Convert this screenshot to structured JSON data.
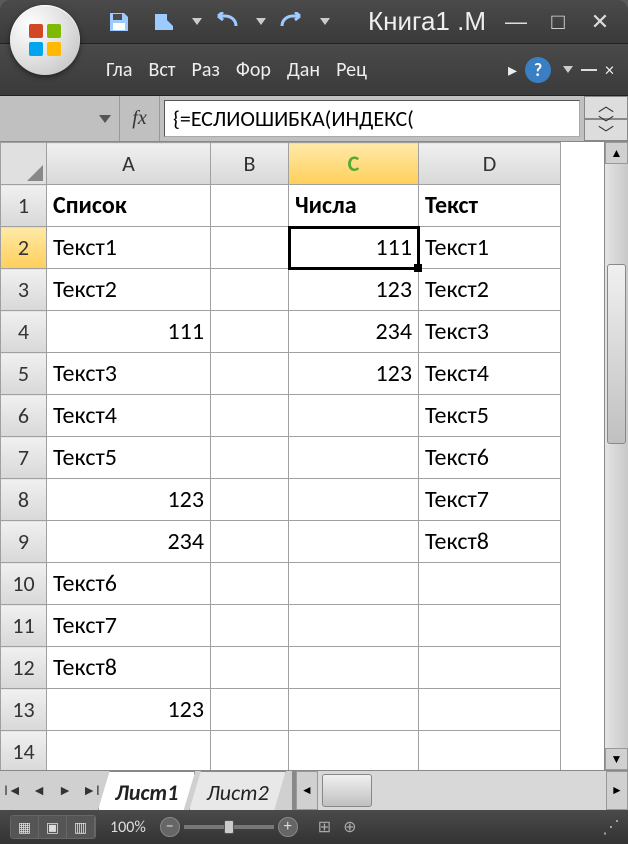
{
  "window": {
    "title": "Книга1 .М"
  },
  "qat": {
    "save": "save",
    "tool2": "tool",
    "undo": "undo",
    "redo": "redo"
  },
  "ribbon": {
    "tabs": [
      "Гла",
      "Вст",
      "Раз",
      "Фор",
      "Дан",
      "Рец"
    ]
  },
  "formula_bar": {
    "fx_label": "fx",
    "formula": "{=ЕСЛИОШИБКА(ИНДЕКС("
  },
  "columns": [
    "A",
    "B",
    "C",
    "D"
  ],
  "col_widths": {
    "rowhead": 46,
    "A": 164,
    "B": 78,
    "C": 130,
    "D": 142
  },
  "header_row": {
    "A": "Список",
    "C": "Числа",
    "D": "Текст"
  },
  "rows": [
    {
      "n": 1
    },
    {
      "n": 2,
      "A": "Текст1",
      "A_align": "txt",
      "C": "111",
      "C_align": "num",
      "D": "Текст1"
    },
    {
      "n": 3,
      "A": "Текст2",
      "A_align": "txt",
      "C": "123",
      "C_align": "num",
      "D": "Текст2"
    },
    {
      "n": 4,
      "A": "111",
      "A_align": "num",
      "C": "234",
      "C_align": "num",
      "D": "Текст3"
    },
    {
      "n": 5,
      "A": "Текст3",
      "A_align": "txt",
      "C": "123",
      "C_align": "num",
      "D": "Текст4"
    },
    {
      "n": 6,
      "A": "Текст4",
      "A_align": "txt",
      "C": "",
      "C_align": "num",
      "D": "Текст5"
    },
    {
      "n": 7,
      "A": "Текст5",
      "A_align": "txt",
      "C": "",
      "C_align": "num",
      "D": "Текст6"
    },
    {
      "n": 8,
      "A": "123",
      "A_align": "num",
      "C": "",
      "C_align": "num",
      "D": "Текст7"
    },
    {
      "n": 9,
      "A": "234",
      "A_align": "num",
      "C": "",
      "C_align": "num",
      "D": "Текст8"
    },
    {
      "n": 10,
      "A": "Текст6",
      "A_align": "txt",
      "C": "",
      "C_align": "num",
      "D": ""
    },
    {
      "n": 11,
      "A": "Текст7",
      "A_align": "txt",
      "C": "",
      "C_align": "num",
      "D": ""
    },
    {
      "n": 12,
      "A": "Текст8",
      "A_align": "txt",
      "C": "",
      "C_align": "num",
      "D": ""
    },
    {
      "n": 13,
      "A": "123",
      "A_align": "num",
      "C": "",
      "C_align": "num",
      "D": ""
    },
    {
      "n": 14,
      "A": "",
      "A_align": "txt",
      "C": "",
      "C_align": "num",
      "D": ""
    }
  ],
  "selection": {
    "row": 2,
    "col": "C"
  },
  "sheets": {
    "active": "Лист1",
    "tabs": [
      "Лист1",
      "Лист2"
    ]
  },
  "status": {
    "zoom": "100%"
  }
}
